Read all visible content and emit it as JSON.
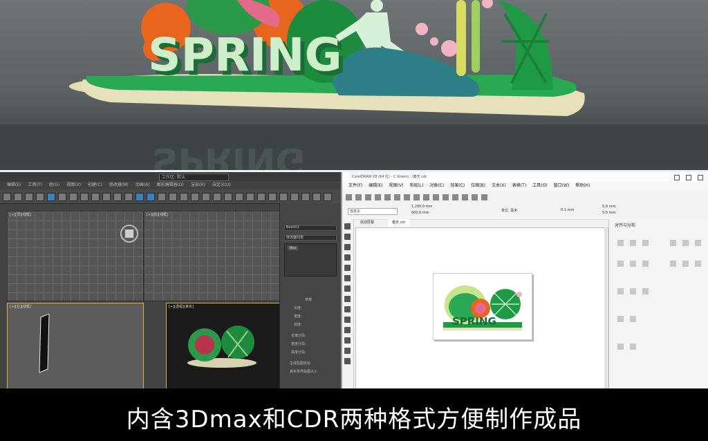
{
  "hero": {
    "sign_text": "SPRING",
    "reflection_text": "SPRING"
  },
  "max_app": {
    "title_box": "工作区: 默认",
    "menu": [
      "编辑(E)",
      "工具(T)",
      "组(G)",
      "视图(V)",
      "创建(C)",
      "修改器(M)",
      "动画(A)",
      "图形编辑器(D)",
      "渲染(R)",
      "自定义(U)",
      "脚本(S)",
      "帮助(H)"
    ],
    "viewports": {
      "top": "[+][顶][线框]",
      "front": "[+][前][线框]",
      "left": "[+][左][线框]",
      "persp": "[+][透视][真实]"
    },
    "command_panel": {
      "name_field": "Box001",
      "modifier_list": "修改器列表",
      "stack_item": "Box",
      "section": "参数",
      "rows": [
        "长度:",
        "宽度:",
        "高度:",
        "长度分段:",
        "宽度分段:",
        "高度分段:"
      ],
      "checks": [
        "生成贴图坐标",
        "真实世界贴图大小"
      ]
    }
  },
  "cdr_app": {
    "title": "CorelDRAW X8 (64 位) - C:\\Users\\...\\春天.cdr",
    "menu": [
      "文件(F)",
      "编辑(E)",
      "视图(V)",
      "布局(L)",
      "对象(C)",
      "效果(C)",
      "位图(B)",
      "文本(X)",
      "表格(T)",
      "工具(O)",
      "窗口(W)",
      "帮助(H)"
    ],
    "preset": "自定义",
    "width_field": "1,200.0 mm",
    "height_field": "600.0 mm",
    "unit_label": "单位: 毫米",
    "nudge": "0.1 mm",
    "dup_x": "5.0 mm",
    "dup_y": "5.0 mm",
    "tabs": [
      "欢迎屏幕",
      "春天.cdr"
    ],
    "dock_title": "对齐与分布",
    "page_sign_text": "SPRING"
  },
  "caption": "内含3Dmax和CDR两种格式方便制作成品",
  "colors": {
    "green": "#1f9a45",
    "light_green": "#8ed7a0",
    "orange": "#e8651e",
    "cream": "#e6e0b8",
    "pink": "#e46a8b"
  },
  "icons": [
    "runner-figure-icon",
    "flower-icon",
    "watermark-icon"
  ]
}
